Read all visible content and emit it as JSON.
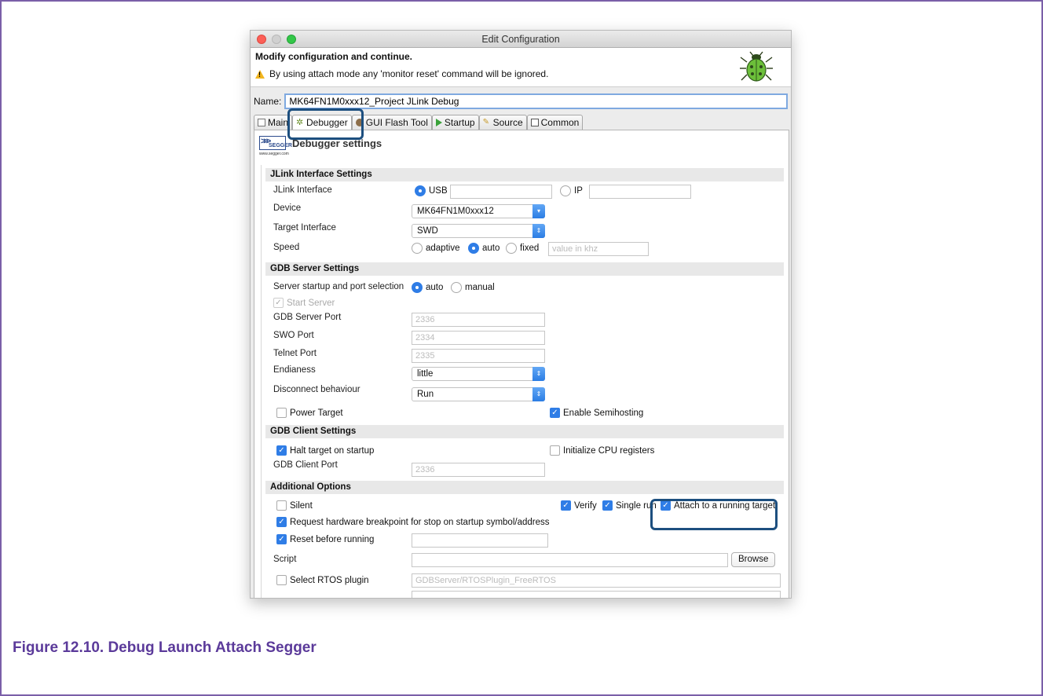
{
  "window": {
    "title": "Edit Configuration"
  },
  "header": {
    "title": "Modify configuration and continue.",
    "message": "By using attach mode any 'monitor reset' command will be ignored."
  },
  "name_row": {
    "label": "Name:",
    "value": "MK64FN1M0xxx12_Project JLink Debug"
  },
  "tabs": [
    {
      "label": "Main"
    },
    {
      "label": "Debugger"
    },
    {
      "label": "GUI Flash Tool"
    },
    {
      "label": "Startup"
    },
    {
      "label": "Source"
    },
    {
      "label": "Common"
    }
  ],
  "segger": {
    "logo_text": "SEGGER",
    "logo_url": "www.segger.com",
    "title": "Debugger settings"
  },
  "jlink": {
    "section": "JLink Interface Settings",
    "interface_label": "JLink Interface",
    "usb_label": "USB",
    "ip_label": "IP",
    "device_label": "Device",
    "device_value": "MK64FN1M0xxx12",
    "target_label": "Target Interface",
    "target_value": "SWD",
    "speed_label": "Speed",
    "speed_adaptive": "adaptive",
    "speed_auto": "auto",
    "speed_fixed": "fixed",
    "speed_placeholder": "value in khz"
  },
  "gdb_server": {
    "section": "GDB Server Settings",
    "startup_label": "Server startup and port selection",
    "auto_label": "auto",
    "manual_label": "manual",
    "start_server_label": "Start Server",
    "port_label": "GDB Server Port",
    "port_value": "2336",
    "swo_label": "SWO Port",
    "swo_value": "2334",
    "telnet_label": "Telnet Port",
    "telnet_value": "2335",
    "endianess_label": "Endianess",
    "endianess_value": "little",
    "disconnect_label": "Disconnect behaviour",
    "disconnect_value": "Run",
    "power_target_label": "Power Target",
    "semihosting_label": "Enable Semihosting"
  },
  "gdb_client": {
    "section": "GDB Client Settings",
    "halt_label": "Halt target on startup",
    "init_cpu_label": "Initialize CPU registers",
    "port_label": "GDB Client Port",
    "port_value": "2336"
  },
  "additional": {
    "section": "Additional Options",
    "silent_label": "Silent",
    "verify_label": "Verify",
    "single_run_label": "Single run",
    "attach_label": "Attach to a running target",
    "hw_bp_label": "Request hardware breakpoint for stop on startup symbol/address",
    "reset_label": "Reset before running",
    "script_label": "Script",
    "browse_label": "Browse",
    "rtos_label": "Select RTOS plugin",
    "rtos_value": "GDBServer/RTOSPlugin_FreeRTOS"
  },
  "caption": "Figure 12.10. Debug Launch Attach Segger",
  "colors": {
    "accent": "#2f7de6",
    "highlight": "#1d4f7f",
    "caption": "#5b3a9a"
  }
}
